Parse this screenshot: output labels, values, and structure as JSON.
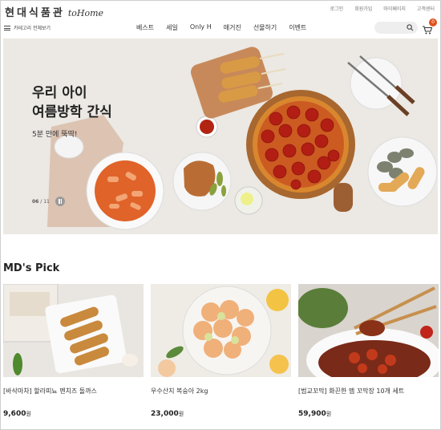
{
  "brand": {
    "name_ko": "현대식품관",
    "name_en": "toHome"
  },
  "util_links": [
    "로그인",
    "회원가입",
    "마이페이지",
    "고객센터"
  ],
  "nav": {
    "category_label": "카테고리 전체보기",
    "menu": [
      "베스트",
      "세일",
      "Only H",
      "매거진",
      "선물하기",
      "이벤트"
    ],
    "cart_count": "0"
  },
  "banner": {
    "title_line1": "우리 아이",
    "title_line2": "여름방학 간식",
    "subtitle": "5분 만에 뚝딱!",
    "page_current": "06",
    "page_total": "/ 11"
  },
  "md_pick": {
    "title": "MD's Pick",
    "products": [
      {
        "name": "[바삭마차] 할라피뇨 멘치즈 돌까스",
        "price": "9,600",
        "unit": "원"
      },
      {
        "name": "우수산지 복숭아 2kg",
        "price": "23,000",
        "unit": "원"
      },
      {
        "name": "[범교꼬막] 화끈한 맵 꼬막장 10개 세트",
        "price": "59,900",
        "unit": "원"
      }
    ]
  },
  "colors": {
    "accent": "#e0501c",
    "banner_bg": "#ece8e3"
  }
}
